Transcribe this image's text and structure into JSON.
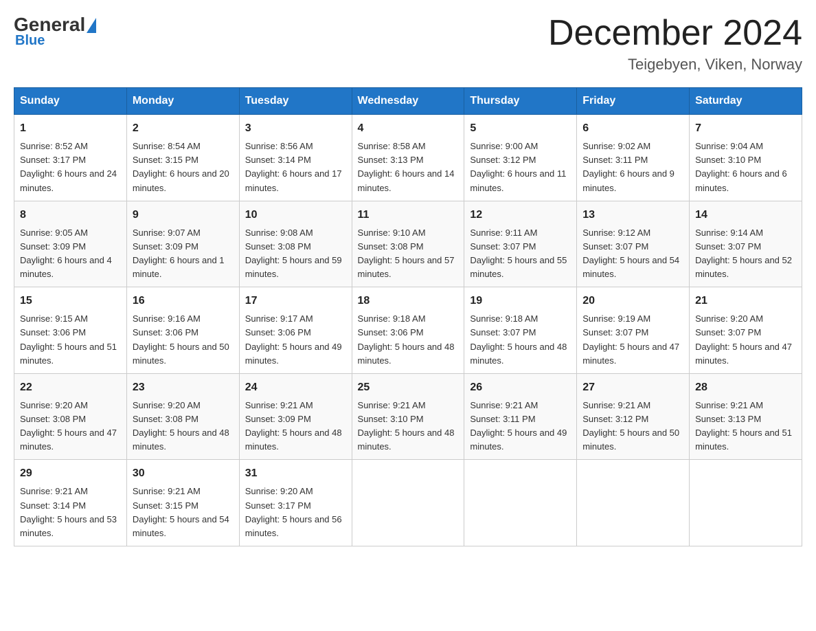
{
  "header": {
    "logo": {
      "general": "General",
      "blue": "Blue"
    },
    "title": "December 2024",
    "location": "Teigebyen, Viken, Norway"
  },
  "columns": [
    "Sunday",
    "Monday",
    "Tuesday",
    "Wednesday",
    "Thursday",
    "Friday",
    "Saturday"
  ],
  "weeks": [
    [
      {
        "day": "1",
        "sunrise": "8:52 AM",
        "sunset": "3:17 PM",
        "daylight": "6 hours and 24 minutes."
      },
      {
        "day": "2",
        "sunrise": "8:54 AM",
        "sunset": "3:15 PM",
        "daylight": "6 hours and 20 minutes."
      },
      {
        "day": "3",
        "sunrise": "8:56 AM",
        "sunset": "3:14 PM",
        "daylight": "6 hours and 17 minutes."
      },
      {
        "day": "4",
        "sunrise": "8:58 AM",
        "sunset": "3:13 PM",
        "daylight": "6 hours and 14 minutes."
      },
      {
        "day": "5",
        "sunrise": "9:00 AM",
        "sunset": "3:12 PM",
        "daylight": "6 hours and 11 minutes."
      },
      {
        "day": "6",
        "sunrise": "9:02 AM",
        "sunset": "3:11 PM",
        "daylight": "6 hours and 9 minutes."
      },
      {
        "day": "7",
        "sunrise": "9:04 AM",
        "sunset": "3:10 PM",
        "daylight": "6 hours and 6 minutes."
      }
    ],
    [
      {
        "day": "8",
        "sunrise": "9:05 AM",
        "sunset": "3:09 PM",
        "daylight": "6 hours and 4 minutes."
      },
      {
        "day": "9",
        "sunrise": "9:07 AM",
        "sunset": "3:09 PM",
        "daylight": "6 hours and 1 minute."
      },
      {
        "day": "10",
        "sunrise": "9:08 AM",
        "sunset": "3:08 PM",
        "daylight": "5 hours and 59 minutes."
      },
      {
        "day": "11",
        "sunrise": "9:10 AM",
        "sunset": "3:08 PM",
        "daylight": "5 hours and 57 minutes."
      },
      {
        "day": "12",
        "sunrise": "9:11 AM",
        "sunset": "3:07 PM",
        "daylight": "5 hours and 55 minutes."
      },
      {
        "day": "13",
        "sunrise": "9:12 AM",
        "sunset": "3:07 PM",
        "daylight": "5 hours and 54 minutes."
      },
      {
        "day": "14",
        "sunrise": "9:14 AM",
        "sunset": "3:07 PM",
        "daylight": "5 hours and 52 minutes."
      }
    ],
    [
      {
        "day": "15",
        "sunrise": "9:15 AM",
        "sunset": "3:06 PM",
        "daylight": "5 hours and 51 minutes."
      },
      {
        "day": "16",
        "sunrise": "9:16 AM",
        "sunset": "3:06 PM",
        "daylight": "5 hours and 50 minutes."
      },
      {
        "day": "17",
        "sunrise": "9:17 AM",
        "sunset": "3:06 PM",
        "daylight": "5 hours and 49 minutes."
      },
      {
        "day": "18",
        "sunrise": "9:18 AM",
        "sunset": "3:06 PM",
        "daylight": "5 hours and 48 minutes."
      },
      {
        "day": "19",
        "sunrise": "9:18 AM",
        "sunset": "3:07 PM",
        "daylight": "5 hours and 48 minutes."
      },
      {
        "day": "20",
        "sunrise": "9:19 AM",
        "sunset": "3:07 PM",
        "daylight": "5 hours and 47 minutes."
      },
      {
        "day": "21",
        "sunrise": "9:20 AM",
        "sunset": "3:07 PM",
        "daylight": "5 hours and 47 minutes."
      }
    ],
    [
      {
        "day": "22",
        "sunrise": "9:20 AM",
        "sunset": "3:08 PM",
        "daylight": "5 hours and 47 minutes."
      },
      {
        "day": "23",
        "sunrise": "9:20 AM",
        "sunset": "3:08 PM",
        "daylight": "5 hours and 48 minutes."
      },
      {
        "day": "24",
        "sunrise": "9:21 AM",
        "sunset": "3:09 PM",
        "daylight": "5 hours and 48 minutes."
      },
      {
        "day": "25",
        "sunrise": "9:21 AM",
        "sunset": "3:10 PM",
        "daylight": "5 hours and 48 minutes."
      },
      {
        "day": "26",
        "sunrise": "9:21 AM",
        "sunset": "3:11 PM",
        "daylight": "5 hours and 49 minutes."
      },
      {
        "day": "27",
        "sunrise": "9:21 AM",
        "sunset": "3:12 PM",
        "daylight": "5 hours and 50 minutes."
      },
      {
        "day": "28",
        "sunrise": "9:21 AM",
        "sunset": "3:13 PM",
        "daylight": "5 hours and 51 minutes."
      }
    ],
    [
      {
        "day": "29",
        "sunrise": "9:21 AM",
        "sunset": "3:14 PM",
        "daylight": "5 hours and 53 minutes."
      },
      {
        "day": "30",
        "sunrise": "9:21 AM",
        "sunset": "3:15 PM",
        "daylight": "5 hours and 54 minutes."
      },
      {
        "day": "31",
        "sunrise": "9:20 AM",
        "sunset": "3:17 PM",
        "daylight": "5 hours and 56 minutes."
      },
      null,
      null,
      null,
      null
    ]
  ]
}
